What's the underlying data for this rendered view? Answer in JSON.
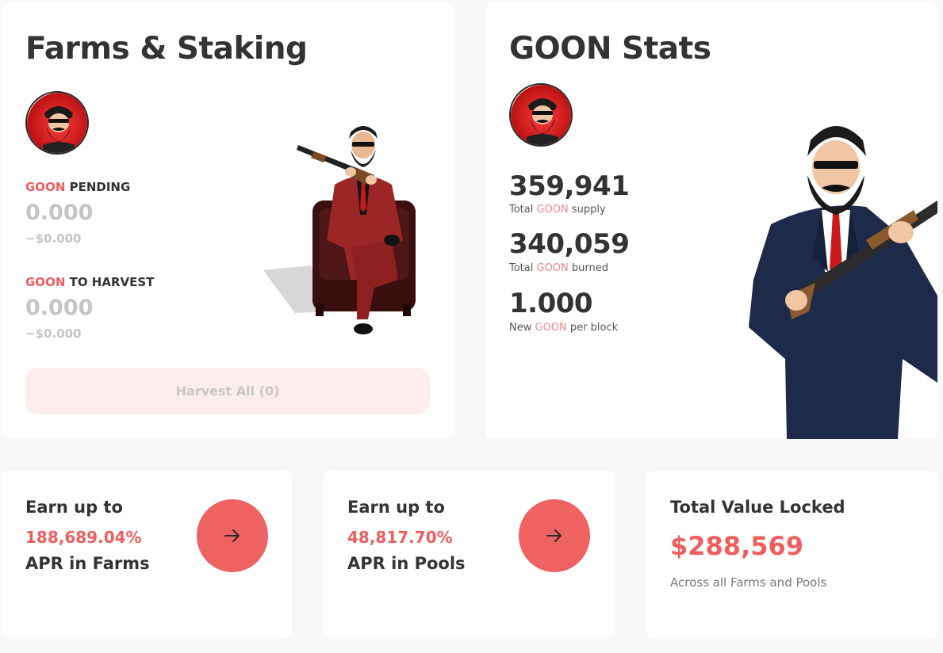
{
  "token": "GOON",
  "farms_staking": {
    "title": "Farms & Staking",
    "pending_label_token": "GOON",
    "pending_label_suffix": " PENDING",
    "pending_value": "0.000",
    "pending_usd": "~$0.000",
    "harvest_label_token": "GOON",
    "harvest_label_suffix": " TO HARVEST",
    "harvest_value": "0.000",
    "harvest_usd": "~$0.000",
    "harvest_all_button": "Harvest All (0)"
  },
  "goon_stats": {
    "title": "GOON Stats",
    "total_supply_value": "359,941",
    "total_supply_prefix": "Total ",
    "total_supply_token": "GOON",
    "total_supply_suffix": " supply",
    "total_burned_value": "340,059",
    "total_burned_prefix": "Total ",
    "total_burned_token": "GOON",
    "total_burned_suffix": " burned",
    "per_block_value": "1.000",
    "per_block_prefix": "New ",
    "per_block_token": "GOON",
    "per_block_suffix": " per block"
  },
  "earn_farms": {
    "line1": "Earn up to",
    "percent": "188,689.04%",
    "line3": "APR in Farms"
  },
  "earn_pools": {
    "line1": "Earn up to",
    "percent": "48,817.70%",
    "line3": "APR in Pools"
  },
  "tvl": {
    "title": "Total Value Locked",
    "value": "$288,569",
    "subtitle": "Across all Farms and Pools"
  },
  "icons": {
    "avatar": "goon-logo-icon",
    "arrow": "arrow-right-icon"
  },
  "colors": {
    "accent": "#ee5e5e",
    "arrow_button": "#ee6262",
    "harvest_button_bg": "#fdedec",
    "muted_value": "#c3c5c8",
    "page_bg": "#f8f8f8"
  }
}
